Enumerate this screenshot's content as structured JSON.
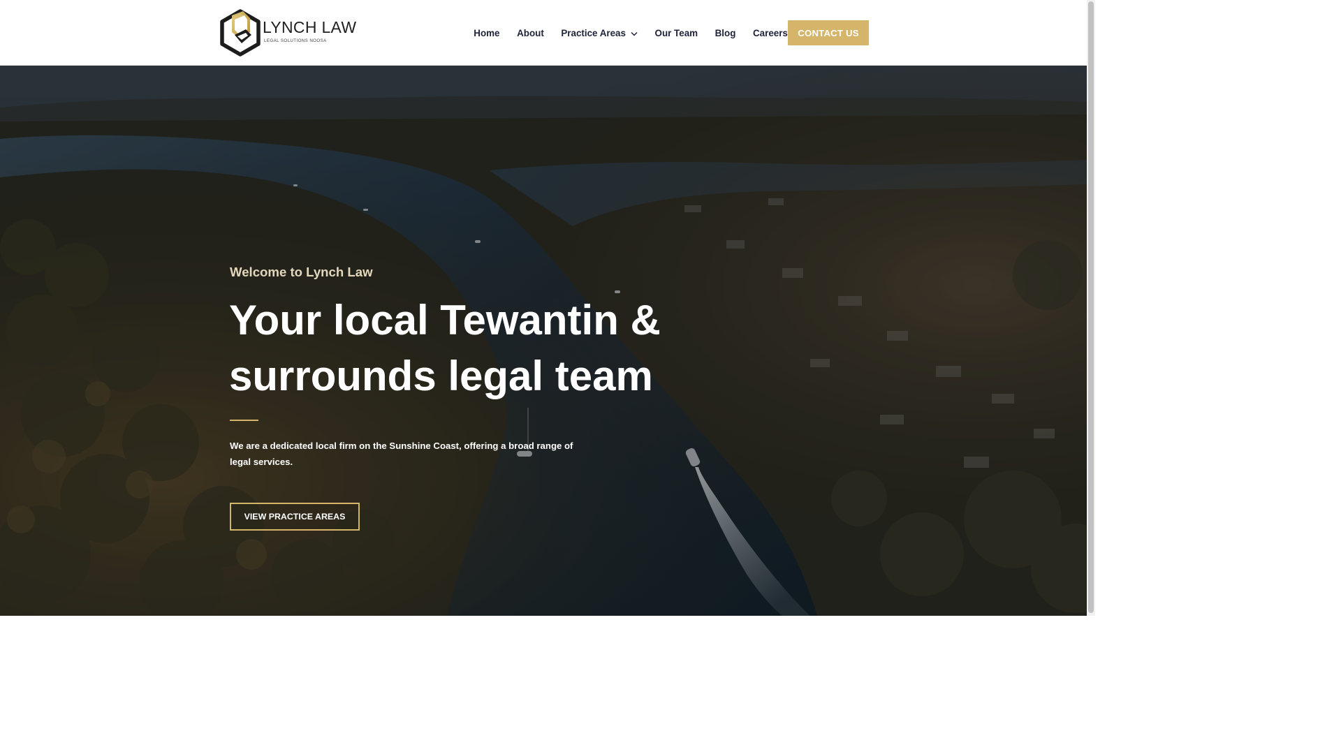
{
  "header": {
    "logo": {
      "brand": "LYNCH LAW",
      "tagline": "LEGAL SOLUTIONS NOOSA"
    },
    "nav": {
      "items": [
        {
          "label": "Home"
        },
        {
          "label": "About"
        },
        {
          "label": "Practice Areas",
          "has_dropdown": true
        },
        {
          "label": "Our Team"
        },
        {
          "label": "Blog"
        },
        {
          "label": "Careers"
        }
      ]
    },
    "cta_label": "CONTACT US"
  },
  "hero": {
    "eyebrow": "Welcome to Lynch Law",
    "headline_line1": "Your local Tewantin &",
    "headline_line2": "surrounds legal team",
    "lead": "We are a dedicated local firm on the Sunshine Coast, offering a broad range of legal services.",
    "button_label": "VIEW PRACTICE AREAS"
  },
  "colors": {
    "accent": "#d4b56a",
    "nav_text": "#20243a",
    "hero_text": "#ffffff",
    "eyebrow_text": "#e4d8bc"
  },
  "icons": {
    "logo_mark": "hexagon-logo-icon",
    "dropdown": "chevron-down-icon"
  }
}
